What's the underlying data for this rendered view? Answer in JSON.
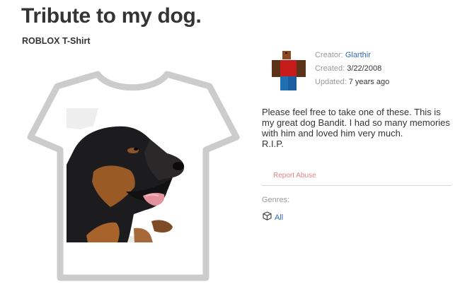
{
  "item": {
    "title": "Tribute to my dog.",
    "type_label": "ROBLOX T-Shirt"
  },
  "details": {
    "creator_label": "Creator:",
    "creator_name": "Glarthir",
    "created_label": "Created:",
    "created_value": "3/22/2008",
    "updated_label": "Updated:",
    "updated_value": "7 years ago"
  },
  "description": "Please feel free to take one of these. This is\nmy great dog Bandit. I had so many memories\nwith him and loved him very much.\nR.I.P.",
  "report_label": "Report Abuse",
  "genres": {
    "label": "Genres:",
    "items": [
      {
        "label": "All",
        "icon": "cube-icon"
      }
    ]
  },
  "colors": {
    "link": "#2b68c6",
    "report": "#e0828a",
    "shirt_outline": "#cccccc",
    "text": "#343434",
    "muted": "#9a9a9a"
  }
}
